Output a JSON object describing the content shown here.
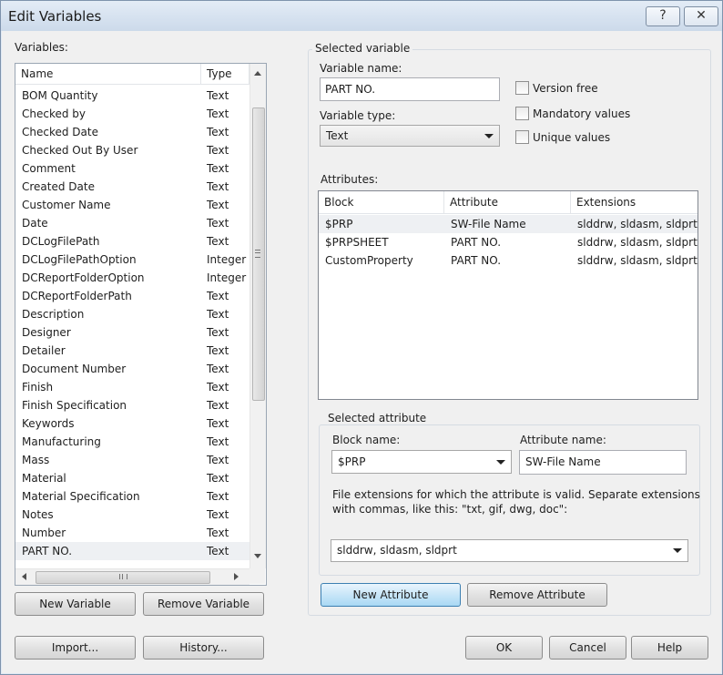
{
  "window": {
    "title": "Edit Variables",
    "help_glyph": "?",
    "close_glyph": "✕"
  },
  "variables": {
    "label": "Variables:",
    "columns": {
      "name": "Name",
      "type": "Type"
    },
    "rows": [
      {
        "name": "BOM Quantity",
        "type": "Text"
      },
      {
        "name": "Checked by",
        "type": "Text"
      },
      {
        "name": "Checked Date",
        "type": "Text"
      },
      {
        "name": "Checked Out By User",
        "type": "Text"
      },
      {
        "name": "Comment",
        "type": "Text"
      },
      {
        "name": "Created Date",
        "type": "Text"
      },
      {
        "name": "Customer Name",
        "type": "Text"
      },
      {
        "name": "Date",
        "type": "Text"
      },
      {
        "name": "DCLogFilePath",
        "type": "Text"
      },
      {
        "name": "DCLogFilePathOption",
        "type": "Integer"
      },
      {
        "name": "DCReportFolderOption",
        "type": "Integer"
      },
      {
        "name": "DCReportFolderPath",
        "type": "Text"
      },
      {
        "name": "Description",
        "type": "Text"
      },
      {
        "name": "Designer",
        "type": "Text"
      },
      {
        "name": "Detailer",
        "type": "Text"
      },
      {
        "name": "Document Number",
        "type": "Text"
      },
      {
        "name": "Finish",
        "type": "Text"
      },
      {
        "name": "Finish Specification",
        "type": "Text"
      },
      {
        "name": "Keywords",
        "type": "Text"
      },
      {
        "name": "Manufacturing",
        "type": "Text"
      },
      {
        "name": "Mass",
        "type": "Text"
      },
      {
        "name": "Material",
        "type": "Text"
      },
      {
        "name": "Material Specification",
        "type": "Text"
      },
      {
        "name": "Notes",
        "type": "Text"
      },
      {
        "name": "Number",
        "type": "Text"
      },
      {
        "name": "PART NO.",
        "type": "Text"
      }
    ],
    "selected_name": "PART NO.",
    "new_button": "New Variable",
    "remove_button": "Remove Variable"
  },
  "selected_variable": {
    "group_label": "Selected variable",
    "name_label": "Variable name:",
    "name_value": "PART NO.",
    "type_label": "Variable type:",
    "type_value": "Text",
    "version_free": "Version free",
    "mandatory_values": "Mandatory values",
    "unique_values": "Unique values",
    "attributes_label": "Attributes:",
    "attr_columns": {
      "block": "Block",
      "attribute": "Attribute",
      "extensions": "Extensions"
    },
    "attr_rows": [
      {
        "block": "$PRP",
        "attribute": "SW-File Name",
        "extensions": "slddrw, sldasm, sldprt"
      },
      {
        "block": "$PRPSHEET",
        "attribute": "PART NO.",
        "extensions": "slddrw, sldasm, sldprt"
      },
      {
        "block": "CustomProperty",
        "attribute": "PART NO.",
        "extensions": "slddrw, sldasm, sldprt"
      }
    ]
  },
  "selected_attribute": {
    "group_label": "Selected attribute",
    "block_label": "Block name:",
    "block_value": "$PRP",
    "attr_label": "Attribute name:",
    "attr_value": "SW-File Name",
    "ext_help_1": "File extensions for which the attribute is valid. Separate extensions",
    "ext_help_2": "with commas, like this: \"txt, gif, dwg, doc\":",
    "ext_value": "slddrw, sldasm, sldprt",
    "new_button": "New Attribute",
    "remove_button": "Remove Attribute"
  },
  "footer": {
    "import": "Import...",
    "history": "History...",
    "ok": "OK",
    "cancel": "Cancel",
    "help": "Help"
  }
}
